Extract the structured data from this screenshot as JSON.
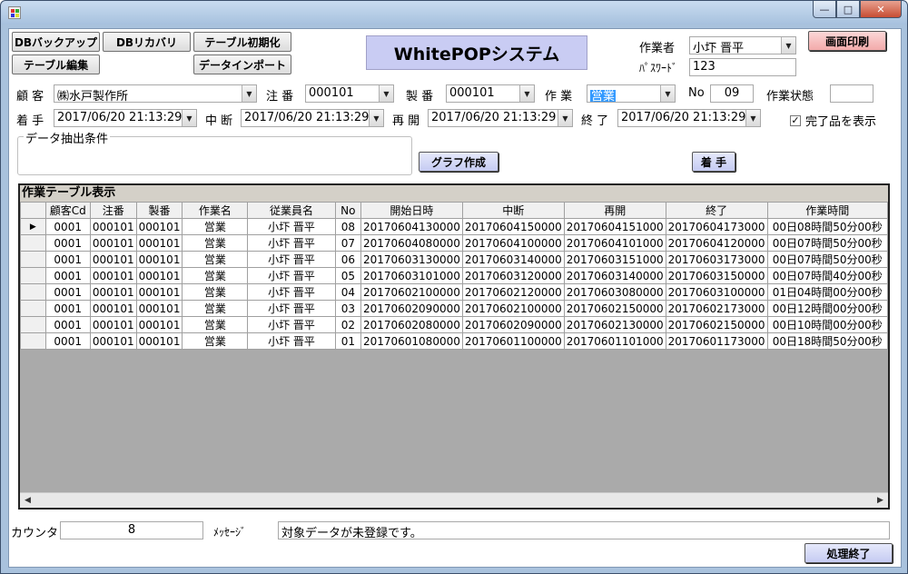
{
  "window": {
    "title": "",
    "min": "—",
    "max": "□",
    "close": "✕"
  },
  "buttons": {
    "db_backup": "DBバックアップ",
    "db_recovery": "DBリカバリ",
    "table_init": "テーブル初期化",
    "table_edit": "テーブル編集",
    "data_import": "データインポート",
    "screen_print": "画面印刷",
    "graph": "グラフ作成",
    "start": "着 手",
    "finish": "処理終了"
  },
  "app_title": "WhitePOPシステム",
  "worker": {
    "label": "作業者",
    "value": "小圷 晋平"
  },
  "password": {
    "label": "ﾊﾟｽﾜｰﾄﾞ",
    "value": "123"
  },
  "customer": {
    "label": "顧 客",
    "value": "㈱水戸製作所"
  },
  "order": {
    "label": "注 番",
    "value": "000101"
  },
  "product": {
    "label": "製 番",
    "value": "000101"
  },
  "task": {
    "label": "作 業",
    "value": "営業"
  },
  "no": {
    "label": "No",
    "value": "09"
  },
  "task_state": {
    "label": "作業状態",
    "value": ""
  },
  "start_dt": {
    "label": "着 手",
    "value": "2017/06/20 21:13:29"
  },
  "pause_dt": {
    "label": "中 断",
    "value": "2017/06/20 21:13:29"
  },
  "resume_dt": {
    "label": "再 開",
    "value": "2017/06/20 21:13:29"
  },
  "end_dt": {
    "label": "終 了",
    "value": "2017/06/20 21:13:29"
  },
  "show_complete": {
    "label": "完了品を表示",
    "checked": true,
    "mark": "✓"
  },
  "filter": {
    "label": "データ抽出条件"
  },
  "table": {
    "caption": "作業テーブル表示",
    "columns": [
      "顧客Cd",
      "注番",
      "製番",
      "作業名",
      "従業員名",
      "No",
      "開始日時",
      "中断",
      "再開",
      "終了",
      "作業時間"
    ],
    "rows": [
      [
        "0001",
        "000101",
        "000101",
        "営業",
        "小圷 晋平",
        "08",
        "20170604130000",
        "20170604150000",
        "20170604151000",
        "20170604173000",
        "00日08時間50分00秒"
      ],
      [
        "0001",
        "000101",
        "000101",
        "営業",
        "小圷 晋平",
        "07",
        "20170604080000",
        "20170604100000",
        "20170604101000",
        "20170604120000",
        "00日07時間50分00秒"
      ],
      [
        "0001",
        "000101",
        "000101",
        "営業",
        "小圷 晋平",
        "06",
        "20170603130000",
        "20170603140000",
        "20170603151000",
        "20170603173000",
        "00日07時間50分00秒"
      ],
      [
        "0001",
        "000101",
        "000101",
        "営業",
        "小圷 晋平",
        "05",
        "20170603101000",
        "20170603120000",
        "20170603140000",
        "20170603150000",
        "00日07時間40分00秒"
      ],
      [
        "0001",
        "000101",
        "000101",
        "営業",
        "小圷 晋平",
        "04",
        "20170602100000",
        "20170602120000",
        "20170603080000",
        "20170603100000",
        "01日04時間00分00秒"
      ],
      [
        "0001",
        "000101",
        "000101",
        "営業",
        "小圷 晋平",
        "03",
        "20170602090000",
        "20170602100000",
        "20170602150000",
        "20170602173000",
        "00日12時間00分00秒"
      ],
      [
        "0001",
        "000101",
        "000101",
        "営業",
        "小圷 晋平",
        "02",
        "20170602080000",
        "20170602090000",
        "20170602130000",
        "20170602150000",
        "00日10時間00分00秒"
      ],
      [
        "0001",
        "000101",
        "000101",
        "営業",
        "小圷 晋平",
        "01",
        "20170601080000",
        "20170601100000",
        "20170601101000",
        "20170601173000",
        "00日18時間50分00秒"
      ]
    ],
    "current_row_marker": "▶"
  },
  "counter": {
    "label": "カウンタ",
    "value": "8"
  },
  "message": {
    "label": "ﾒｯｾｰｼﾞ",
    "value": "対象データが未登録です。"
  },
  "colors": {
    "title_bg": "#c9ccf3",
    "button_blue": "#c5cbf2",
    "button_pink": "#f2aaaa",
    "selection": "#3399ff"
  }
}
